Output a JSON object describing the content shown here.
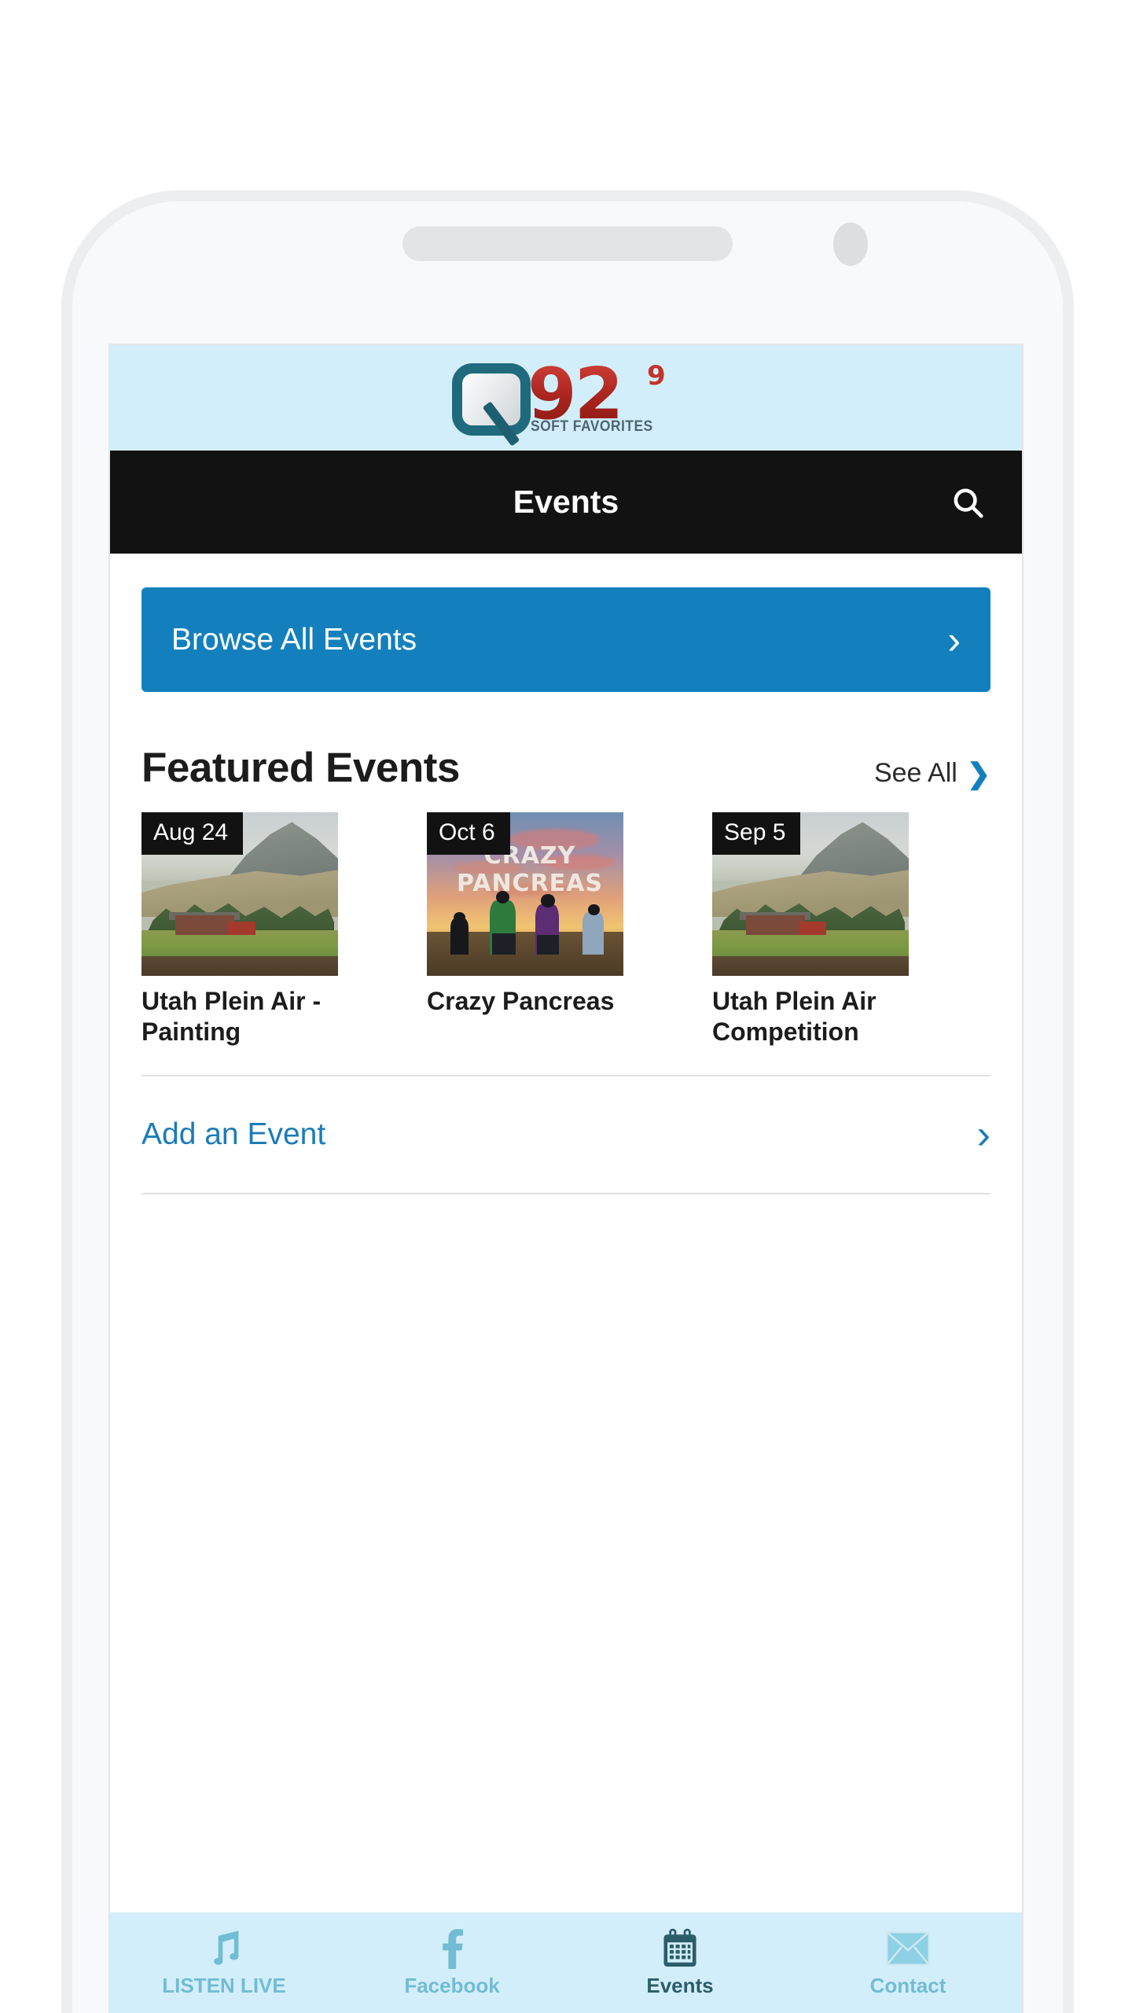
{
  "device": {
    "speaker_icon": "speaker-grille",
    "camera_icon": "front-camera"
  },
  "brand": {
    "logo_mark": "Q",
    "logo_number": "92",
    "logo_superscript": "9",
    "logo_tagline": "SOFT FAVORITES",
    "logo_band_color": "#d2eefa",
    "logo_teal": "#1f6b7d",
    "logo_red": "#b02a23"
  },
  "header": {
    "title": "Events",
    "background_color": "#121212",
    "search_icon": "search-icon"
  },
  "browse_all": {
    "label": "Browse All Events",
    "chevron_icon": "chevron-right-icon",
    "accent_color": "#1380bd"
  },
  "featured": {
    "title": "Featured Events",
    "see_all_label": "See All",
    "see_all_chevron_icon": "chevron-right-icon",
    "events": [
      {
        "date_badge": "Aug 24",
        "name": "Utah Plein Air - Painting",
        "thumbnail": "landscape-painting-mountain-barn"
      },
      {
        "date_badge": "Oct 6",
        "name": "Crazy Pancreas",
        "thumbnail": "sunset-cyclists-photo",
        "image_overlay_text": "CRAZY PANCREAS"
      },
      {
        "date_badge": "Sep 5",
        "name": "Utah Plein Air Competition",
        "thumbnail": "landscape-painting-mountain-barn"
      }
    ]
  },
  "add_event": {
    "label": "Add an Event",
    "chevron_icon": "chevron-right-icon",
    "link_color": "#1a7cb8"
  },
  "bottom_nav": {
    "background_color": "#d2eefa",
    "inactive_color": "#72bcd4",
    "active_color": "#2b5d6b",
    "items": [
      {
        "label": "LISTEN LIVE",
        "icon": "music-note-icon",
        "active": false
      },
      {
        "label": "Facebook",
        "icon": "facebook-icon",
        "active": false
      },
      {
        "label": "Events",
        "icon": "calendar-icon",
        "active": true
      },
      {
        "label": "Contact",
        "icon": "envelope-icon",
        "active": false
      }
    ]
  }
}
